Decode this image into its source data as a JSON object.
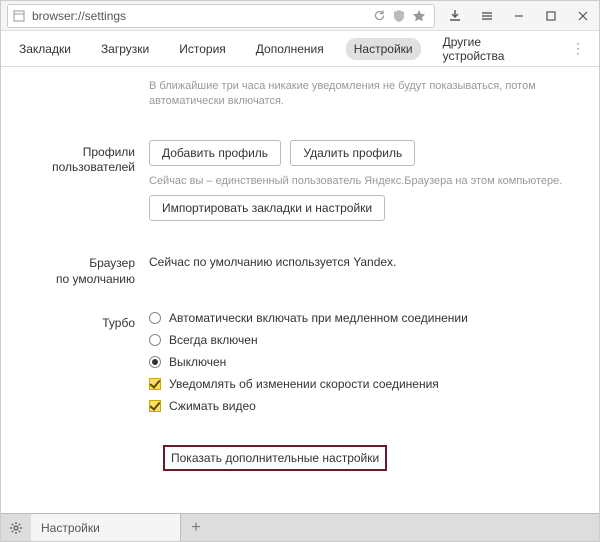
{
  "titlebar": {
    "url": "browser://settings"
  },
  "navbar": {
    "items": [
      "Закладки",
      "Загрузки",
      "История",
      "Дополнения",
      "Настройки",
      "Другие устройства"
    ],
    "active_index": 4
  },
  "sections": {
    "notice": {
      "hint": "В ближайшие три часа никакие уведомления не будут показываться, потом автоматически включатся."
    },
    "profiles": {
      "label1": "Профили",
      "label2": "пользователей",
      "add": "Добавить профиль",
      "remove": "Удалить профиль",
      "hint": "Сейчас вы – единственный пользователь Яндекс.Браузера на этом компьютере.",
      "import": "Импортировать закладки и настройки"
    },
    "default_browser": {
      "label1": "Браузер",
      "label2": "по умолчанию",
      "text": "Сейчас по умолчанию используется Yandex."
    },
    "turbo": {
      "label": "Турбо",
      "r1": "Автоматически включать при медленном соединении",
      "r2": "Всегда включен",
      "r3": "Выключен",
      "c1": "Уведомлять об изменении скорости соединения",
      "c2": "Сжимать видео",
      "selected_radio": 2,
      "check1": true,
      "check2": true
    },
    "advanced": "Показать дополнительные настройки"
  },
  "tabbar": {
    "active_tab": "Настройки"
  }
}
